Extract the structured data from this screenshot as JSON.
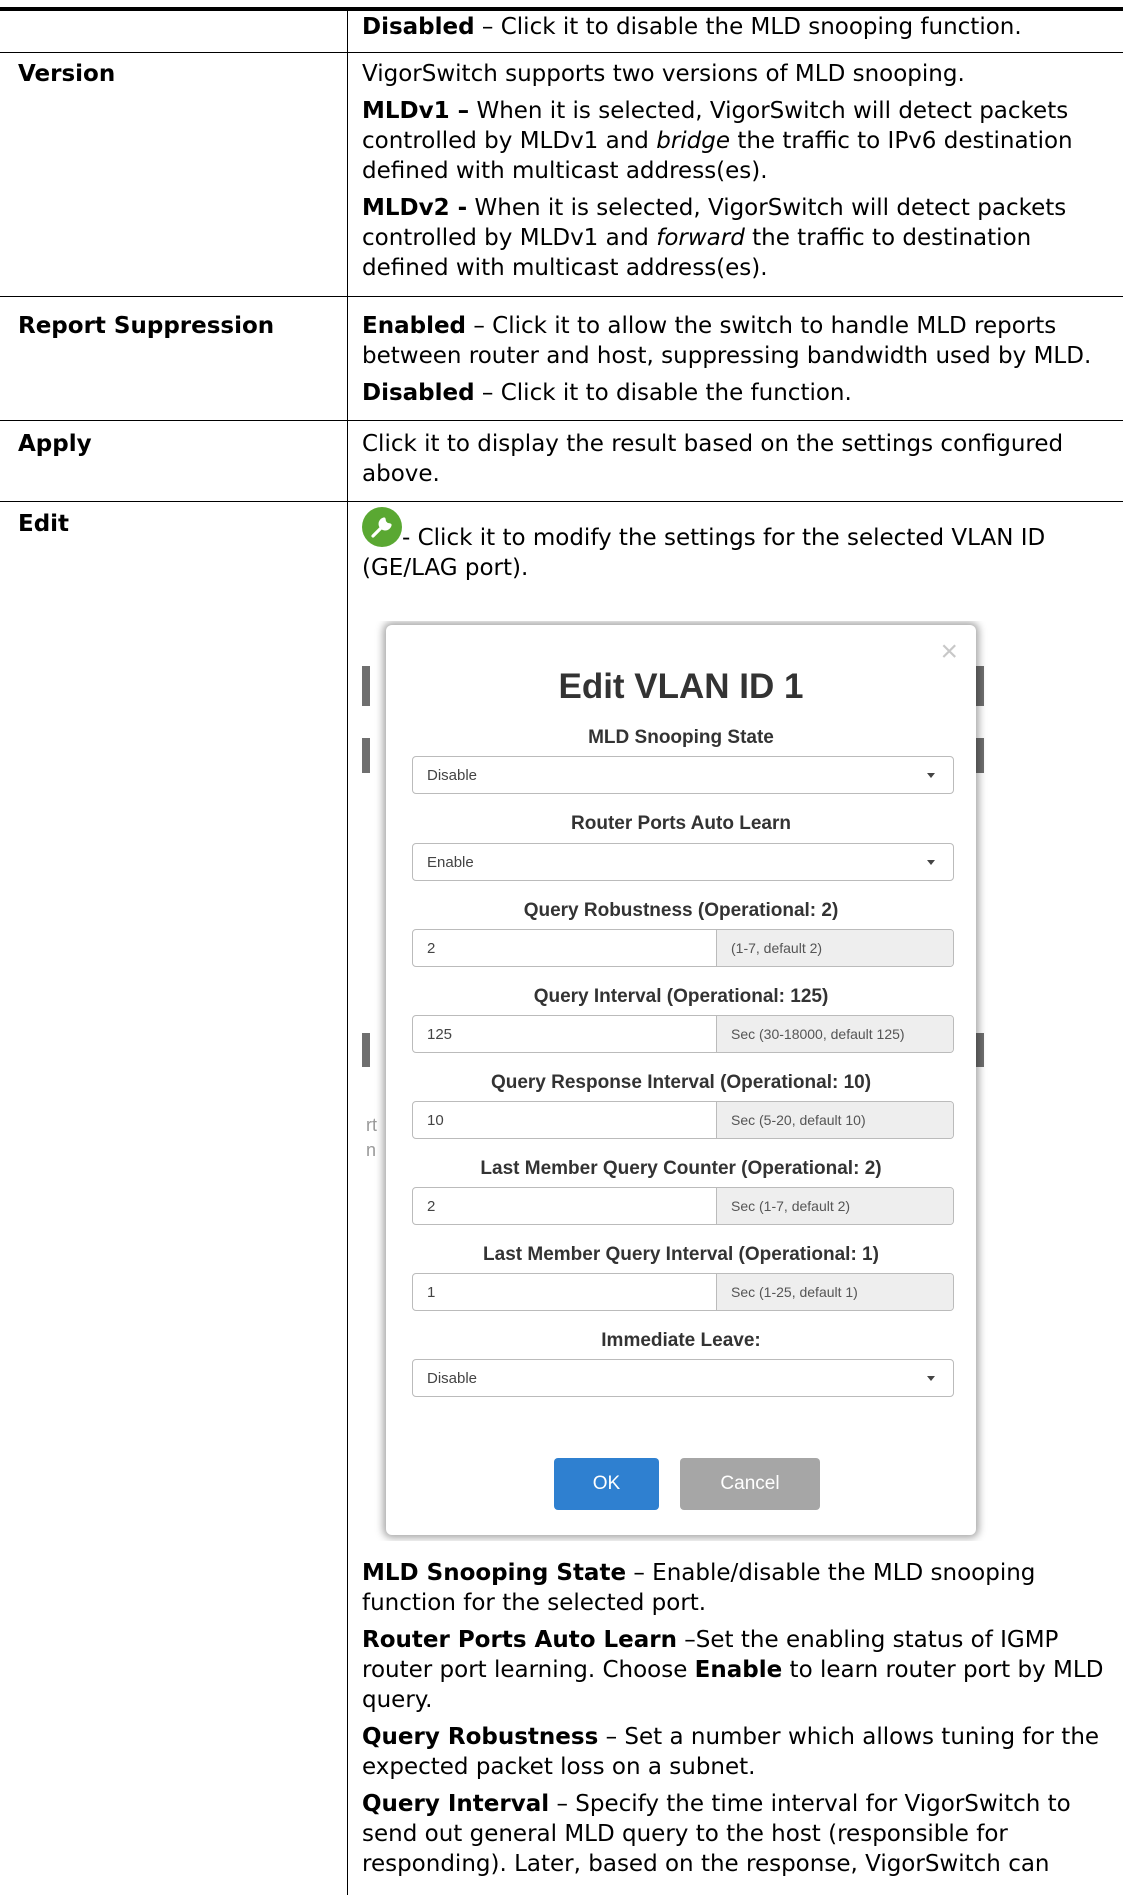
{
  "rows": {
    "enable_mld": {
      "disabled_term": "Disabled",
      "disabled_text": " – Click it to disable the MLD snooping function."
    },
    "version": {
      "label": "Version",
      "intro": "VigorSwitch supports two versions of MLD snooping.",
      "v1_term": "MLDv1 –",
      "v1_text_a": " When it is selected, VigorSwitch will detect packets controlled by MLDv1 and ",
      "v1_em": "bridge",
      "v1_text_b": " the traffic to IPv6 destination defined with multicast address(es).",
      "v2_term": "MLDv2 -",
      "v2_text_a": " When it is selected, VigorSwitch will detect packets controlled by MLDv1 and ",
      "v2_em": "forward",
      "v2_text_b": " the traffic to destination defined with multicast address(es)."
    },
    "report_suppression": {
      "label": "Report Suppression",
      "enabled_term": "Enabled",
      "enabled_text": " – Click it to allow the switch to handle MLD reports between router and host, suppressing bandwidth used by MLD.",
      "disabled_term": "Disabled",
      "disabled_text": " – Click it to disable the function."
    },
    "apply": {
      "label": "Apply",
      "text": "Click it to display the result based on the settings configured above."
    },
    "edit": {
      "label": "Edit",
      "icon_text": "- Click it to modify the settings for the selected VLAN ID (GE/LAG port).",
      "icon": "wrench-icon",
      "icon_color": "#5aa832",
      "state_term": "MLD Snooping State",
      "state_text": " – Enable/disable the MLD snooping function for the selected port.",
      "autolearn_term": "Router Ports Auto Learn",
      "autolearn_text_a": " –Set the enabling status of IGMP router port learning. Choose ",
      "autolearn_em": "Enable",
      "autolearn_text_b": " to learn router port by MLD query.",
      "robust_term": "Query Robustness",
      "robust_text": " – Set a number which allows tuning for the expected packet loss on a subnet.",
      "interval_term": "Query Interval",
      "interval_text": " – Specify the time interval for VigorSwitch to send out general MLD query to the host (responsible for responding). Later, based on the response, VigorSwitch can"
    }
  },
  "modal": {
    "close": "×",
    "title": "Edit VLAN ID 1",
    "snooping_state_label": "MLD Snooping State",
    "snooping_state_value": "Disable",
    "auto_learn_label": "Router Ports Auto Learn",
    "auto_learn_value": "Enable",
    "robustness_label": "Query Robustness (Operational: 2)",
    "robustness_value": "2",
    "robustness_hint": "(1-7, default 2)",
    "interval_label": "Query Interval (Operational: 125)",
    "interval_value": "125",
    "interval_hint": "Sec (30-18000, default 125)",
    "response_label": "Query Response Interval (Operational: 10)",
    "response_value": "10",
    "response_hint": "Sec (5-20, default 10)",
    "lmq_counter_label": "Last Member Query Counter (Operational: 2)",
    "lmq_counter_value": "2",
    "lmq_counter_hint": "Sec (1-7, default 2)",
    "lmq_interval_label": "Last Member Query Interval (Operational: 1)",
    "lmq_interval_value": "1",
    "lmq_interval_hint": "Sec (1-25, default 1)",
    "immediate_leave_label": "Immediate Leave:",
    "immediate_leave_value": "Disable",
    "ok": "OK",
    "cancel": "Cancel",
    "ok_color": "#2f80d0",
    "cancel_color": "#a6a6a6"
  },
  "background_fragments": {
    "frag1": "rt",
    "frag2": "n"
  }
}
